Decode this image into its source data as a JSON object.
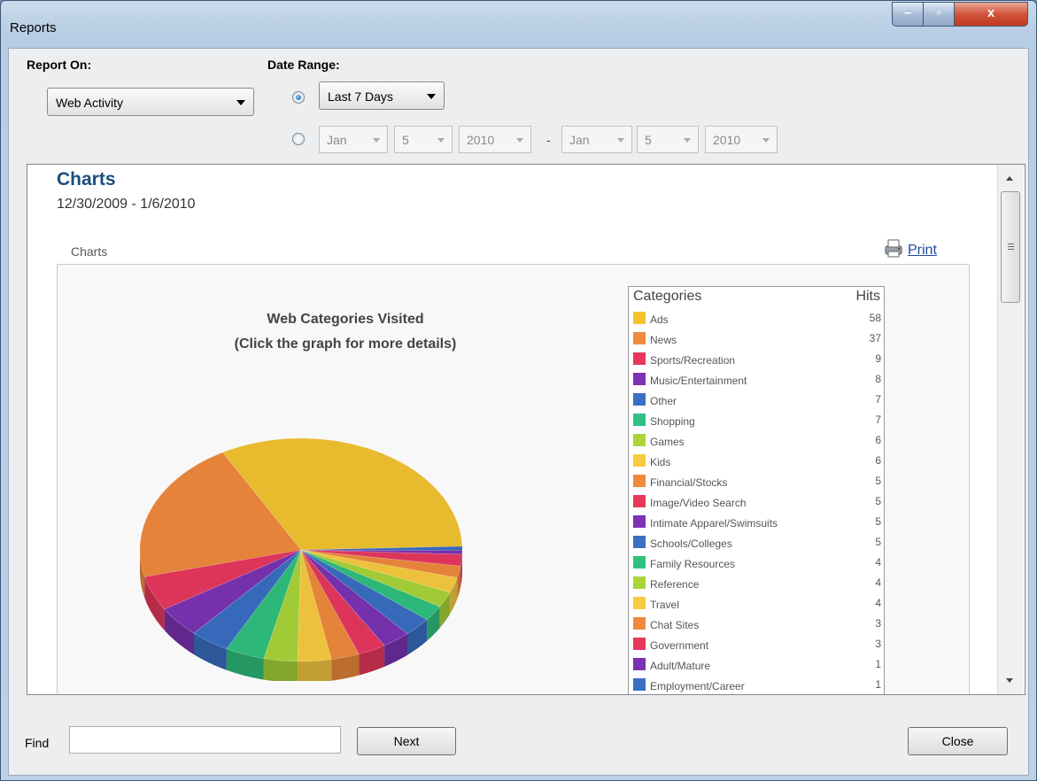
{
  "window": {
    "title": "Reports",
    "controls": {
      "minimize": "–",
      "maximize": "▫",
      "close": "x"
    }
  },
  "toolbar": {
    "report_on_label": "Report On:",
    "report_on_value": "Web Activity",
    "date_range_label": "Date Range:",
    "preset_selected": true,
    "preset_value": "Last 7 Days",
    "custom_range": {
      "from": {
        "month": "Jan",
        "day": "5",
        "year": "2010"
      },
      "separator": "-",
      "to": {
        "month": "Jan",
        "day": "5",
        "year": "2010"
      }
    }
  },
  "report": {
    "heading": "Charts",
    "date_range": "12/30/2009 - 1/6/2010",
    "section_label": "Charts",
    "print_label": "Print"
  },
  "chart_data": {
    "type": "pie",
    "title": "Web Categories Visited",
    "subtitle": "(Click the graph for more details)",
    "legend_header": {
      "category": "Categories",
      "hits": "Hits"
    },
    "categories": [
      "Ads",
      "News",
      "Sports/Recreation",
      "Music/Entertainment",
      "Other",
      "Shopping",
      "Games",
      "Kids",
      "Financial/Stocks",
      "Image/Video Search",
      "Intimate Apparel/Swimsuits",
      "Schools/Colleges",
      "Family Resources",
      "Reference",
      "Travel",
      "Chat Sites",
      "Government",
      "Adult/Mature",
      "Employment/Career"
    ],
    "values": [
      58,
      37,
      9,
      8,
      7,
      7,
      6,
      6,
      5,
      5,
      5,
      5,
      4,
      4,
      4,
      3,
      3,
      1,
      1
    ],
    "colors": [
      "#f4c430",
      "#f08a3c",
      "#e8385e",
      "#7b32b5",
      "#3a6fc4",
      "#2fc17e",
      "#a8d63a",
      "#f8cc40",
      "#f08a3c",
      "#e8385e",
      "#7b32b5",
      "#3a6fc4",
      "#2fc17e",
      "#a8d63a",
      "#f8cc40",
      "#f08a3c",
      "#e8385e",
      "#7b32b5",
      "#3a6fc4"
    ],
    "legend_placement": "right"
  },
  "footer": {
    "find_label": "Find",
    "find_value": "",
    "next_label": "Next",
    "close_label": "Close"
  }
}
